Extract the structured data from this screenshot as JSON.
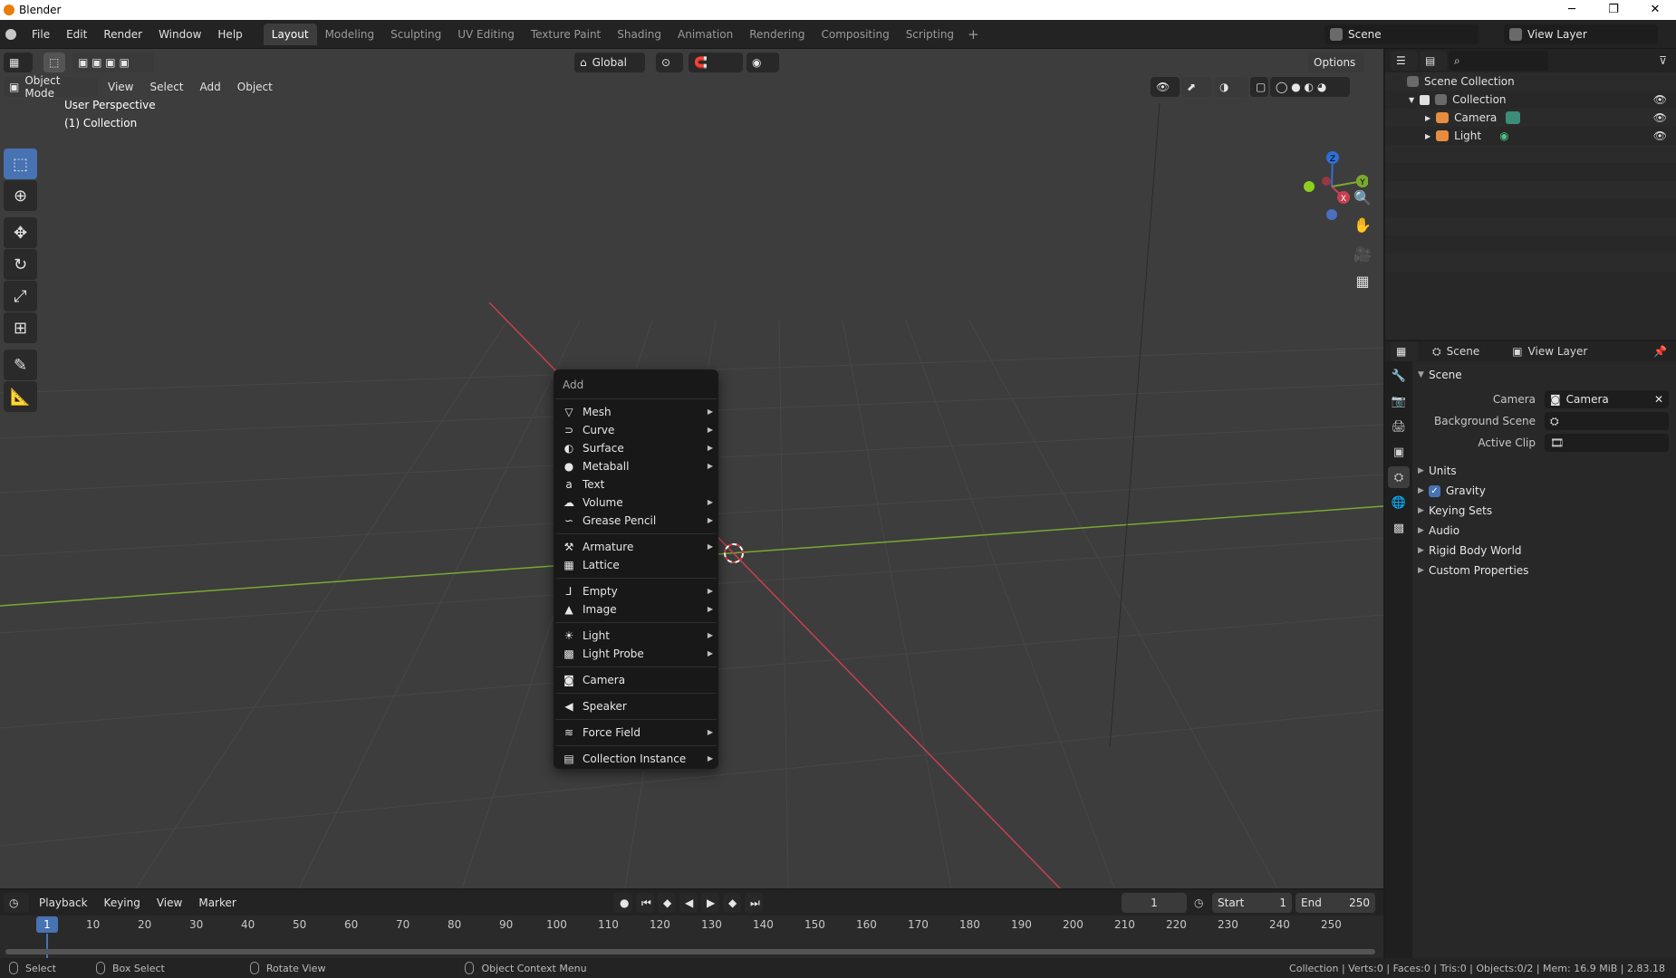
{
  "window": {
    "title": "Blender",
    "minimize": "─",
    "maximize": "❐",
    "close": "✕"
  },
  "menubar": [
    "File",
    "Edit",
    "Render",
    "Window",
    "Help"
  ],
  "workspaces": [
    "Layout",
    "Modeling",
    "Sculpting",
    "UV Editing",
    "Texture Paint",
    "Shading",
    "Animation",
    "Rendering",
    "Compositing",
    "Scripting"
  ],
  "workspace_add": "+",
  "scene": {
    "name": "Scene",
    "view_layer": "View Layer"
  },
  "viewport": {
    "orientation": "Global",
    "options": "Options",
    "mode": "Object Mode",
    "menus": [
      "View",
      "Select",
      "Add",
      "Object"
    ],
    "perspective": "User Perspective",
    "collection": "(1) Collection",
    "gizmo": {
      "z": "Z",
      "y": "Y",
      "x": "X"
    }
  },
  "add_menu": {
    "title": "Add",
    "items": [
      {
        "label": "Mesh",
        "icon": "mesh-icon",
        "glyph": "▽",
        "submenu": true
      },
      {
        "label": "Curve",
        "icon": "curve-icon",
        "glyph": "⊃",
        "submenu": true
      },
      {
        "label": "Surface",
        "icon": "surface-icon",
        "glyph": "◐",
        "submenu": true
      },
      {
        "label": "Metaball",
        "icon": "metaball-icon",
        "glyph": "●",
        "submenu": true
      },
      {
        "label": "Text",
        "icon": "text-icon",
        "glyph": "a",
        "submenu": false
      },
      {
        "label": "Volume",
        "icon": "volume-icon",
        "glyph": "☁",
        "submenu": true
      },
      {
        "label": "Grease Pencil",
        "icon": "grease-pencil-icon",
        "glyph": "∽",
        "submenu": true
      },
      {
        "label": "Armature",
        "icon": "armature-icon",
        "glyph": "⚒",
        "submenu": true
      },
      {
        "label": "Lattice",
        "icon": "lattice-icon",
        "glyph": "▦",
        "submenu": false
      },
      {
        "label": "Empty",
        "icon": "empty-icon",
        "glyph": "⅃",
        "submenu": true
      },
      {
        "label": "Image",
        "icon": "image-icon",
        "glyph": "▲",
        "submenu": true
      },
      {
        "label": "Light",
        "icon": "light-icon",
        "glyph": "☀",
        "submenu": true
      },
      {
        "label": "Light Probe",
        "icon": "light-probe-icon",
        "glyph": "▩",
        "submenu": true
      },
      {
        "label": "Camera",
        "icon": "camera-icon",
        "glyph": "◙",
        "submenu": false
      },
      {
        "label": "Speaker",
        "icon": "speaker-icon",
        "glyph": "◀",
        "submenu": false
      },
      {
        "label": "Force Field",
        "icon": "force-field-icon",
        "glyph": "≋",
        "submenu": true
      },
      {
        "label": "Collection Instance",
        "icon": "collection-instance-icon",
        "glyph": "▤",
        "submenu": true
      }
    ]
  },
  "outliner": {
    "rows": [
      {
        "label": "Scene Collection",
        "indent": 0
      },
      {
        "label": "Collection",
        "indent": 1
      },
      {
        "label": "Camera",
        "indent": 2
      },
      {
        "label": "Light",
        "indent": 2
      }
    ]
  },
  "properties": {
    "header_scene": "Scene",
    "header_view_layer": "View Layer",
    "panel_title": "Scene",
    "camera_label": "Camera",
    "camera_value": "Camera",
    "background_scene_label": "Background Scene",
    "active_clip_label": "Active Clip",
    "subpanels": [
      "Units",
      "Gravity",
      "Keying Sets",
      "Audio",
      "Rigid Body World",
      "Custom Properties"
    ]
  },
  "timeline": {
    "menus": [
      "Playback",
      "Keying",
      "View",
      "Marker"
    ],
    "current_frame": "1",
    "start_label": "Start",
    "start": "1",
    "end_label": "End",
    "end": "250",
    "ruler": [
      "10",
      "20",
      "30",
      "40",
      "50",
      "60",
      "70",
      "80",
      "90",
      "100",
      "110",
      "120",
      "130",
      "140",
      "150",
      "160",
      "170",
      "180",
      "190",
      "200",
      "210",
      "220",
      "230",
      "240",
      "250"
    ]
  },
  "statusbar": {
    "select": "Select",
    "box_select": "Box Select",
    "rotate_view": "Rotate View",
    "context_menu": "Object Context Menu",
    "stats": "Collection | Verts:0 | Faces:0 | Tris:0 | Objects:0/2 | Mem: 16.9 MiB | 2.83.18"
  },
  "colors": {
    "accent": "#4772b3",
    "x_axis": "#c8404f",
    "y_axis": "#7ba832"
  }
}
